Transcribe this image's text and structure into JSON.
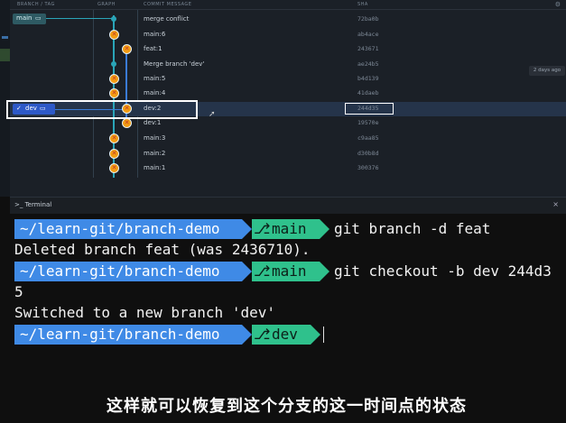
{
  "graph": {
    "headers": {
      "branch_tag": "BRANCH / TAG",
      "graph": "GRAPH",
      "commit_message": "COMMIT MESSAGE",
      "sha": "SHA"
    },
    "main_branch_label": "main",
    "dev_branch_label": "dev",
    "days_ago": "2 days ago",
    "commits": [
      {
        "message": "merge conflict",
        "sha": "72ba0b"
      },
      {
        "message": "main:6",
        "sha": "ab4ace"
      },
      {
        "message": "feat:1",
        "sha": "243671"
      },
      {
        "message": "Merge branch 'dev'",
        "sha": "ae24b5"
      },
      {
        "message": "main:5",
        "sha": "b4d139"
      },
      {
        "message": "main:4",
        "sha": "41daeb"
      },
      {
        "message": "dev:2",
        "sha": "244d35"
      },
      {
        "message": "dev:1",
        "sha": "19570e"
      },
      {
        "message": "main:3",
        "sha": "c9aa85"
      },
      {
        "message": "main:2",
        "sha": "d30b8d"
      },
      {
        "message": "main:1",
        "sha": "300376"
      }
    ]
  },
  "terminal": {
    "title": ">_ Terminal",
    "close_glyph": "×",
    "prompt_path": "~/learn-git/branch-demo",
    "git_glyph": "⎇",
    "lines": [
      {
        "branch": "main",
        "command": "git branch -d feat"
      },
      {
        "branch": "main",
        "command": "git checkout -b dev 244d3"
      },
      {
        "branch": "dev",
        "command": ""
      }
    ],
    "outputs": [
      "Deleted branch feat (was 2436710).",
      "5",
      "Switched to a new branch 'dev'"
    ]
  },
  "subtitle": "这样就可以恢复到这个分支的这一时间点的状态",
  "colors": {
    "prompt_path_bg": "#3f8ae6",
    "prompt_git_bg": "#2fc18c",
    "main_lane": "#2aa5b8",
    "dev_lane": "#3b7bd6",
    "selected_row": "#25344a"
  }
}
